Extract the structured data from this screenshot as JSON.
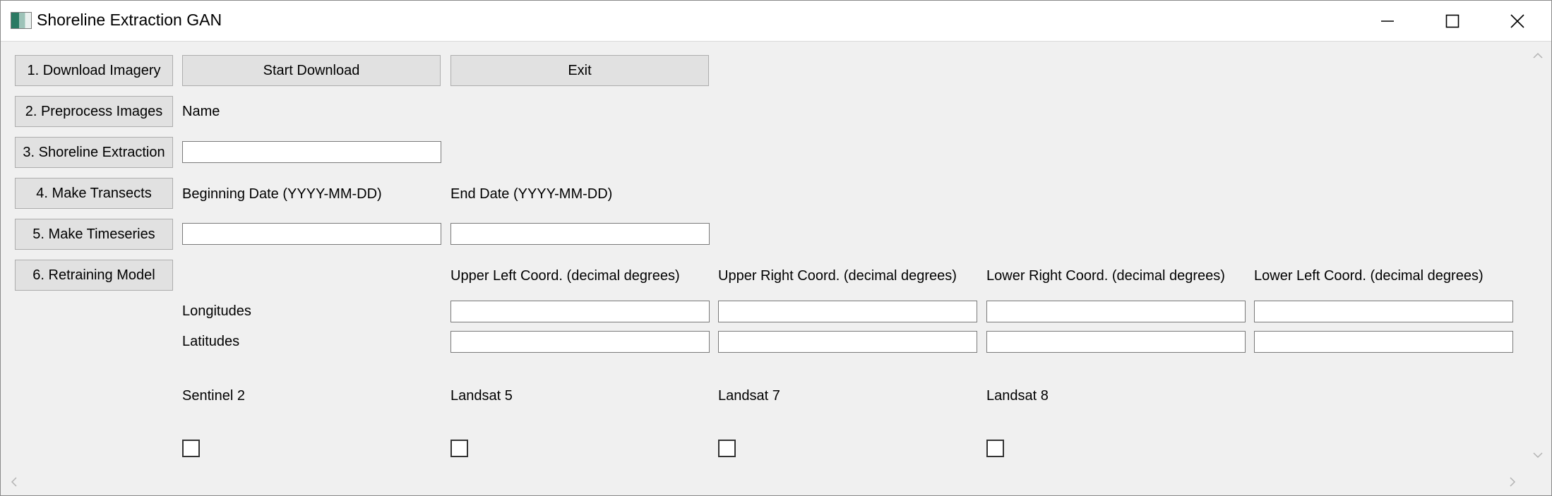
{
  "window": {
    "title": "Shoreline Extraction GAN"
  },
  "sidebar": {
    "items": [
      {
        "label": "1. Download Imagery"
      },
      {
        "label": "2. Preprocess Images"
      },
      {
        "label": "3. Shoreline Extraction"
      },
      {
        "label": "4. Make Transects"
      },
      {
        "label": "5. Make Timeseries"
      },
      {
        "label": "6. Retraining Model"
      }
    ]
  },
  "actions": {
    "start_download": "Start Download",
    "exit": "Exit"
  },
  "form": {
    "name_label": "Name",
    "name_value": "",
    "begin_date_label": "Beginning Date (YYYY-MM-DD)",
    "begin_date_value": "",
    "end_date_label": "End Date (YYYY-MM-DD)",
    "end_date_value": "",
    "coord_headers": [
      "Upper Left Coord. (decimal degrees)",
      "Upper Right Coord. (decimal degrees)",
      "Lower Right Coord. (decimal degrees)",
      "Lower Left Coord. (decimal degrees)"
    ],
    "longitudes_label": "Longitudes",
    "latitudes_label": "Latitudes",
    "longitudes": [
      "",
      "",
      "",
      ""
    ],
    "latitudes": [
      "",
      "",
      "",
      ""
    ],
    "satellites": [
      {
        "label": "Sentinel 2",
        "checked": false
      },
      {
        "label": "Landsat 5",
        "checked": false
      },
      {
        "label": "Landsat 7",
        "checked": false
      },
      {
        "label": "Landsat 8",
        "checked": false
      }
    ]
  },
  "icons": {
    "minimize": "minimize-icon",
    "maximize": "maximize-icon",
    "close": "close-icon"
  }
}
